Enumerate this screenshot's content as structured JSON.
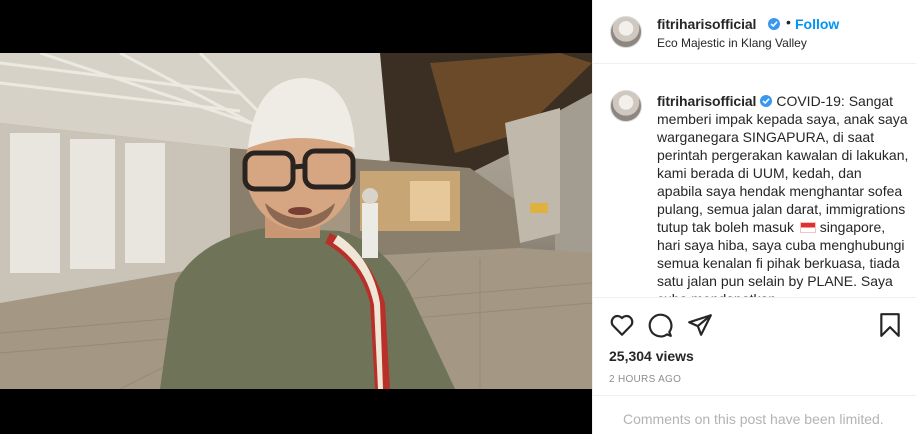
{
  "post": {
    "username": "fitriharisofficial",
    "follow_label": "Follow",
    "separator": "•",
    "location": "Eco Majestic in Klang Valley"
  },
  "caption": {
    "username": "fitriharisofficial",
    "text_part1": "COVID-19: Sangat memberi impak kepada saya, anak saya warganegara SINGAPURA, di saat perintah pergerakan kawalan di lakukan, kami berada di UUM, kedah, dan apabila saya hendak menghantar sofea pulang, semua jalan darat, immigrations tutup tak boleh masuk",
    "text_part2": "singapore, hari saya hiba, saya cuba menghubungi semua kenalan fi pihak berkuasa, tiada satu jalan pun selain by PLANE. Saya cuba mendapatkan"
  },
  "stats": {
    "views": "25,304 views",
    "time_ago": "2 HOURS AGO"
  },
  "comments": {
    "limited_text": "Comments on this post have been limited."
  },
  "icons": [
    "heart-icon",
    "comment-icon",
    "share-icon",
    "bookmark-icon",
    "verified-badge-icon",
    "singapore-flag-icon"
  ],
  "colors": {
    "link": "#0095f6",
    "verified": "#3897f0",
    "muted": "#8e8e8e",
    "border": "#efefef"
  }
}
